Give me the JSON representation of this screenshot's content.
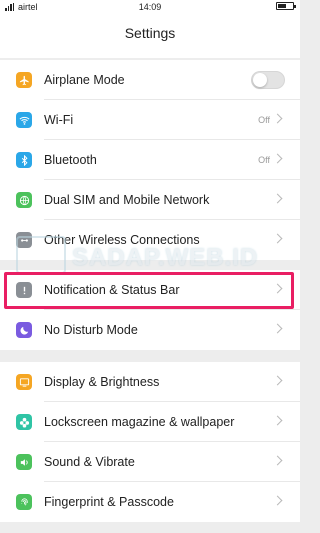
{
  "status_bar": {
    "carrier": "airtel",
    "time": "14:09",
    "battery_level": 0.55
  },
  "header": {
    "title": "Settings"
  },
  "groups": [
    {
      "items": [
        {
          "label": "Airplane Mode",
          "icon": "airplane-icon",
          "color": "#f5a623",
          "control": "toggle",
          "toggle_on": false
        },
        {
          "label": "Wi-Fi",
          "icon": "wifi-icon",
          "color": "#2aa7e8",
          "value": "Off"
        },
        {
          "label": "Bluetooth",
          "icon": "bluetooth-icon",
          "color": "#2aa7e8",
          "value": "Off"
        },
        {
          "label": "Dual SIM and Mobile Network",
          "icon": "globe-icon",
          "color": "#4cc25c"
        },
        {
          "label": "Other Wireless Connections",
          "icon": "link-icon",
          "color": "#8a8f95"
        }
      ]
    },
    {
      "items": [
        {
          "label": "Notification & Status Bar",
          "icon": "notification-icon",
          "color": "#8a8f95"
        },
        {
          "label": "No Disturb Mode",
          "icon": "moon-icon",
          "color": "#7a5be0"
        }
      ]
    },
    {
      "items": [
        {
          "label": "Display & Brightness",
          "icon": "display-icon",
          "color": "#f5a623"
        },
        {
          "label": "Lockscreen magazine & wallpaper",
          "icon": "flower-icon",
          "color": "#2fc4a5"
        },
        {
          "label": "Sound & Vibrate",
          "icon": "speaker-icon",
          "color": "#4cc25c"
        },
        {
          "label": "Fingerprint & Passcode",
          "icon": "fingerprint-icon",
          "color": "#4cc25c"
        }
      ]
    }
  ],
  "watermark": {
    "text": "SADAP.WEB.ID"
  }
}
